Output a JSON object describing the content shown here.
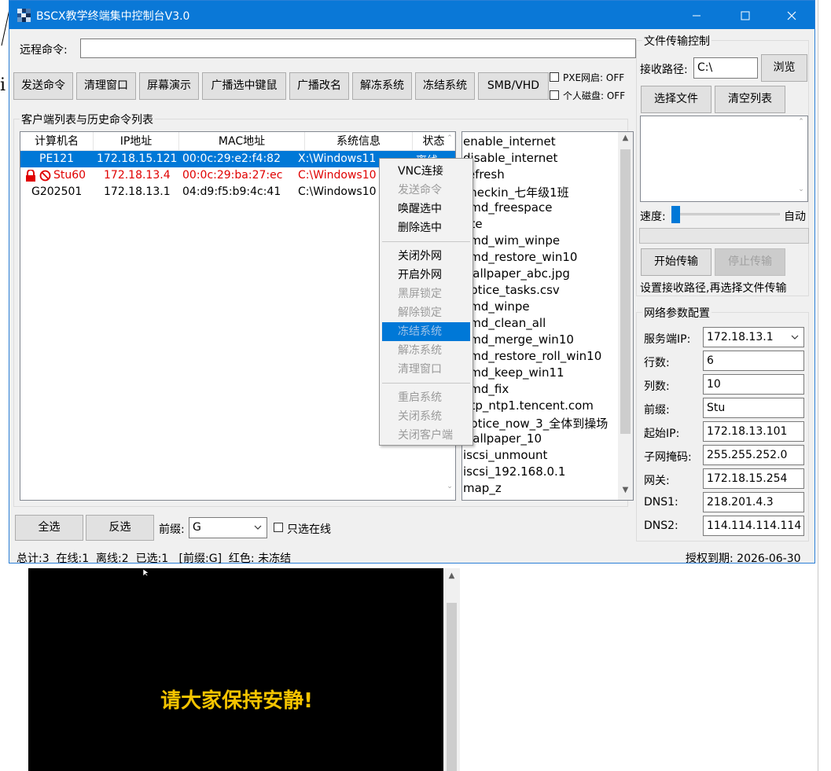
{
  "window": {
    "title": "BSCX教学终端集中控制台V3.0",
    "minimize_icon": "minimize-icon",
    "maximize_icon": "maximize-icon",
    "close_icon": "close-icon"
  },
  "remote": {
    "label": "远程命令:",
    "value": ""
  },
  "toolbar": {
    "send_cmd": "发送命令",
    "clear_window": "清理窗口",
    "screen_demo": "屏幕演示",
    "broadcast_kbm": "广播选中键鼠",
    "broadcast_rename": "广播改名",
    "unfreeze": "解冻系统",
    "freeze": "冻结系统",
    "smb_vhd": "SMB/VHD",
    "pxe": "PXE网启: OFF",
    "personal_disk": "个人磁盘: OFF"
  },
  "client_list": {
    "group_title": "客户端列表与历史命令列表",
    "columns": [
      "计算机名",
      "IP地址",
      "MAC地址",
      "系统信息",
      "状态"
    ],
    "rows": [
      {
        "name": "PE121",
        "ip": "172.18.15.121",
        "mac": "00:0c:29:e2:f4:82",
        "sys": "X:\\Windows11",
        "status": "离线",
        "selected": true
      },
      {
        "name": "Stu60",
        "ip": "172.18.13.4",
        "mac": "00:0c:29:ba:27:ec",
        "sys": "C:\\Windows10",
        "status": "",
        "red": true
      },
      {
        "name": "G202501",
        "ip": "172.18.13.1",
        "mac": "04:d9:f5:b9:4c:41",
        "sys": "C:\\Windows10",
        "status": ""
      }
    ]
  },
  "history": [
    "enable_internet",
    "disable_internet",
    "refresh",
    "checkin_七年级1班",
    "cmd_freespace",
    "pte",
    "cmd_wim_winpe",
    "cmd_restore_win10",
    "wallpaper_abc.jpg",
    "notice_tasks.csv",
    "cmd_winpe",
    "cmd_clean_all",
    "cmd_merge_win10",
    "cmd_restore_roll_win10",
    "cmd_keep_win11",
    "cmd_fix",
    "ntp_ntp1.tencent.com",
    "notice_now_3_全体到操场",
    "wallpaper_10",
    "iscsi_unmount",
    "iscsi_192.168.0.1",
    "map_z"
  ],
  "context_menu": {
    "items": [
      {
        "label": "VNC连接",
        "disabled": false
      },
      {
        "label": "发送命令",
        "disabled": true
      },
      {
        "label": "唤醒选中",
        "disabled": false
      },
      {
        "label": "删除选中",
        "disabled": false
      },
      {
        "label": "关闭外网",
        "disabled": false
      },
      {
        "label": "开启外网",
        "disabled": false
      },
      {
        "label": "黑屏锁定",
        "disabled": true
      },
      {
        "label": "解除锁定",
        "disabled": true
      },
      {
        "label": "冻结系统",
        "disabled": true,
        "highlighted": true
      },
      {
        "label": "解冻系统",
        "disabled": true
      },
      {
        "label": "清理窗口",
        "disabled": true
      },
      {
        "label": "重启系统",
        "disabled": true
      },
      {
        "label": "关闭系统",
        "disabled": true
      },
      {
        "label": "关闭客户端",
        "disabled": true
      }
    ]
  },
  "bottom": {
    "select_all": "全选",
    "invert": "反选",
    "prefix_label": "前缀:",
    "prefix_value": "G",
    "online_only": "只选在线"
  },
  "status_bar": {
    "summary": "总计:3  在线:1  离线:2  已选:1   [前缀:G]  红色: 未冻结",
    "license": "授权到期: 2026-06-30"
  },
  "file_transfer": {
    "title": "文件传输控制",
    "recv_label": "接收路径:",
    "recv_value": "C:\\",
    "browse": "浏览",
    "choose_file": "选择文件",
    "clear_list": "清空列表",
    "speed_label": "速度:",
    "speed_mode": "自动",
    "progress": 0,
    "start": "开始传输",
    "stop": "停止传输",
    "hint": "设置接收路径,再选择文件传输"
  },
  "network": {
    "title": "网络参数配置",
    "fields": [
      {
        "label": "服务端IP:",
        "value": "172.18.13.1"
      },
      {
        "label": "行数:",
        "value": "6"
      },
      {
        "label": "列数:",
        "value": "10"
      },
      {
        "label": "前缀:",
        "value": "Stu"
      },
      {
        "label": "起始IP:",
        "value": "172.18.13.101"
      },
      {
        "label": "子网掩码:",
        "value": "255.255.252.0"
      },
      {
        "label": "网关:",
        "value": "172.18.15.254"
      },
      {
        "label": "DNS1:",
        "value": "218.201.4.3"
      },
      {
        "label": "DNS2:",
        "value": "114.114.114.114"
      }
    ]
  },
  "preview": {
    "message": "请大家保持安静!"
  },
  "colors": {
    "title_bar": "#0a78d7",
    "selection": "#0078d7",
    "offline_red": "#e00000",
    "message_yellow": "#f5c400"
  }
}
